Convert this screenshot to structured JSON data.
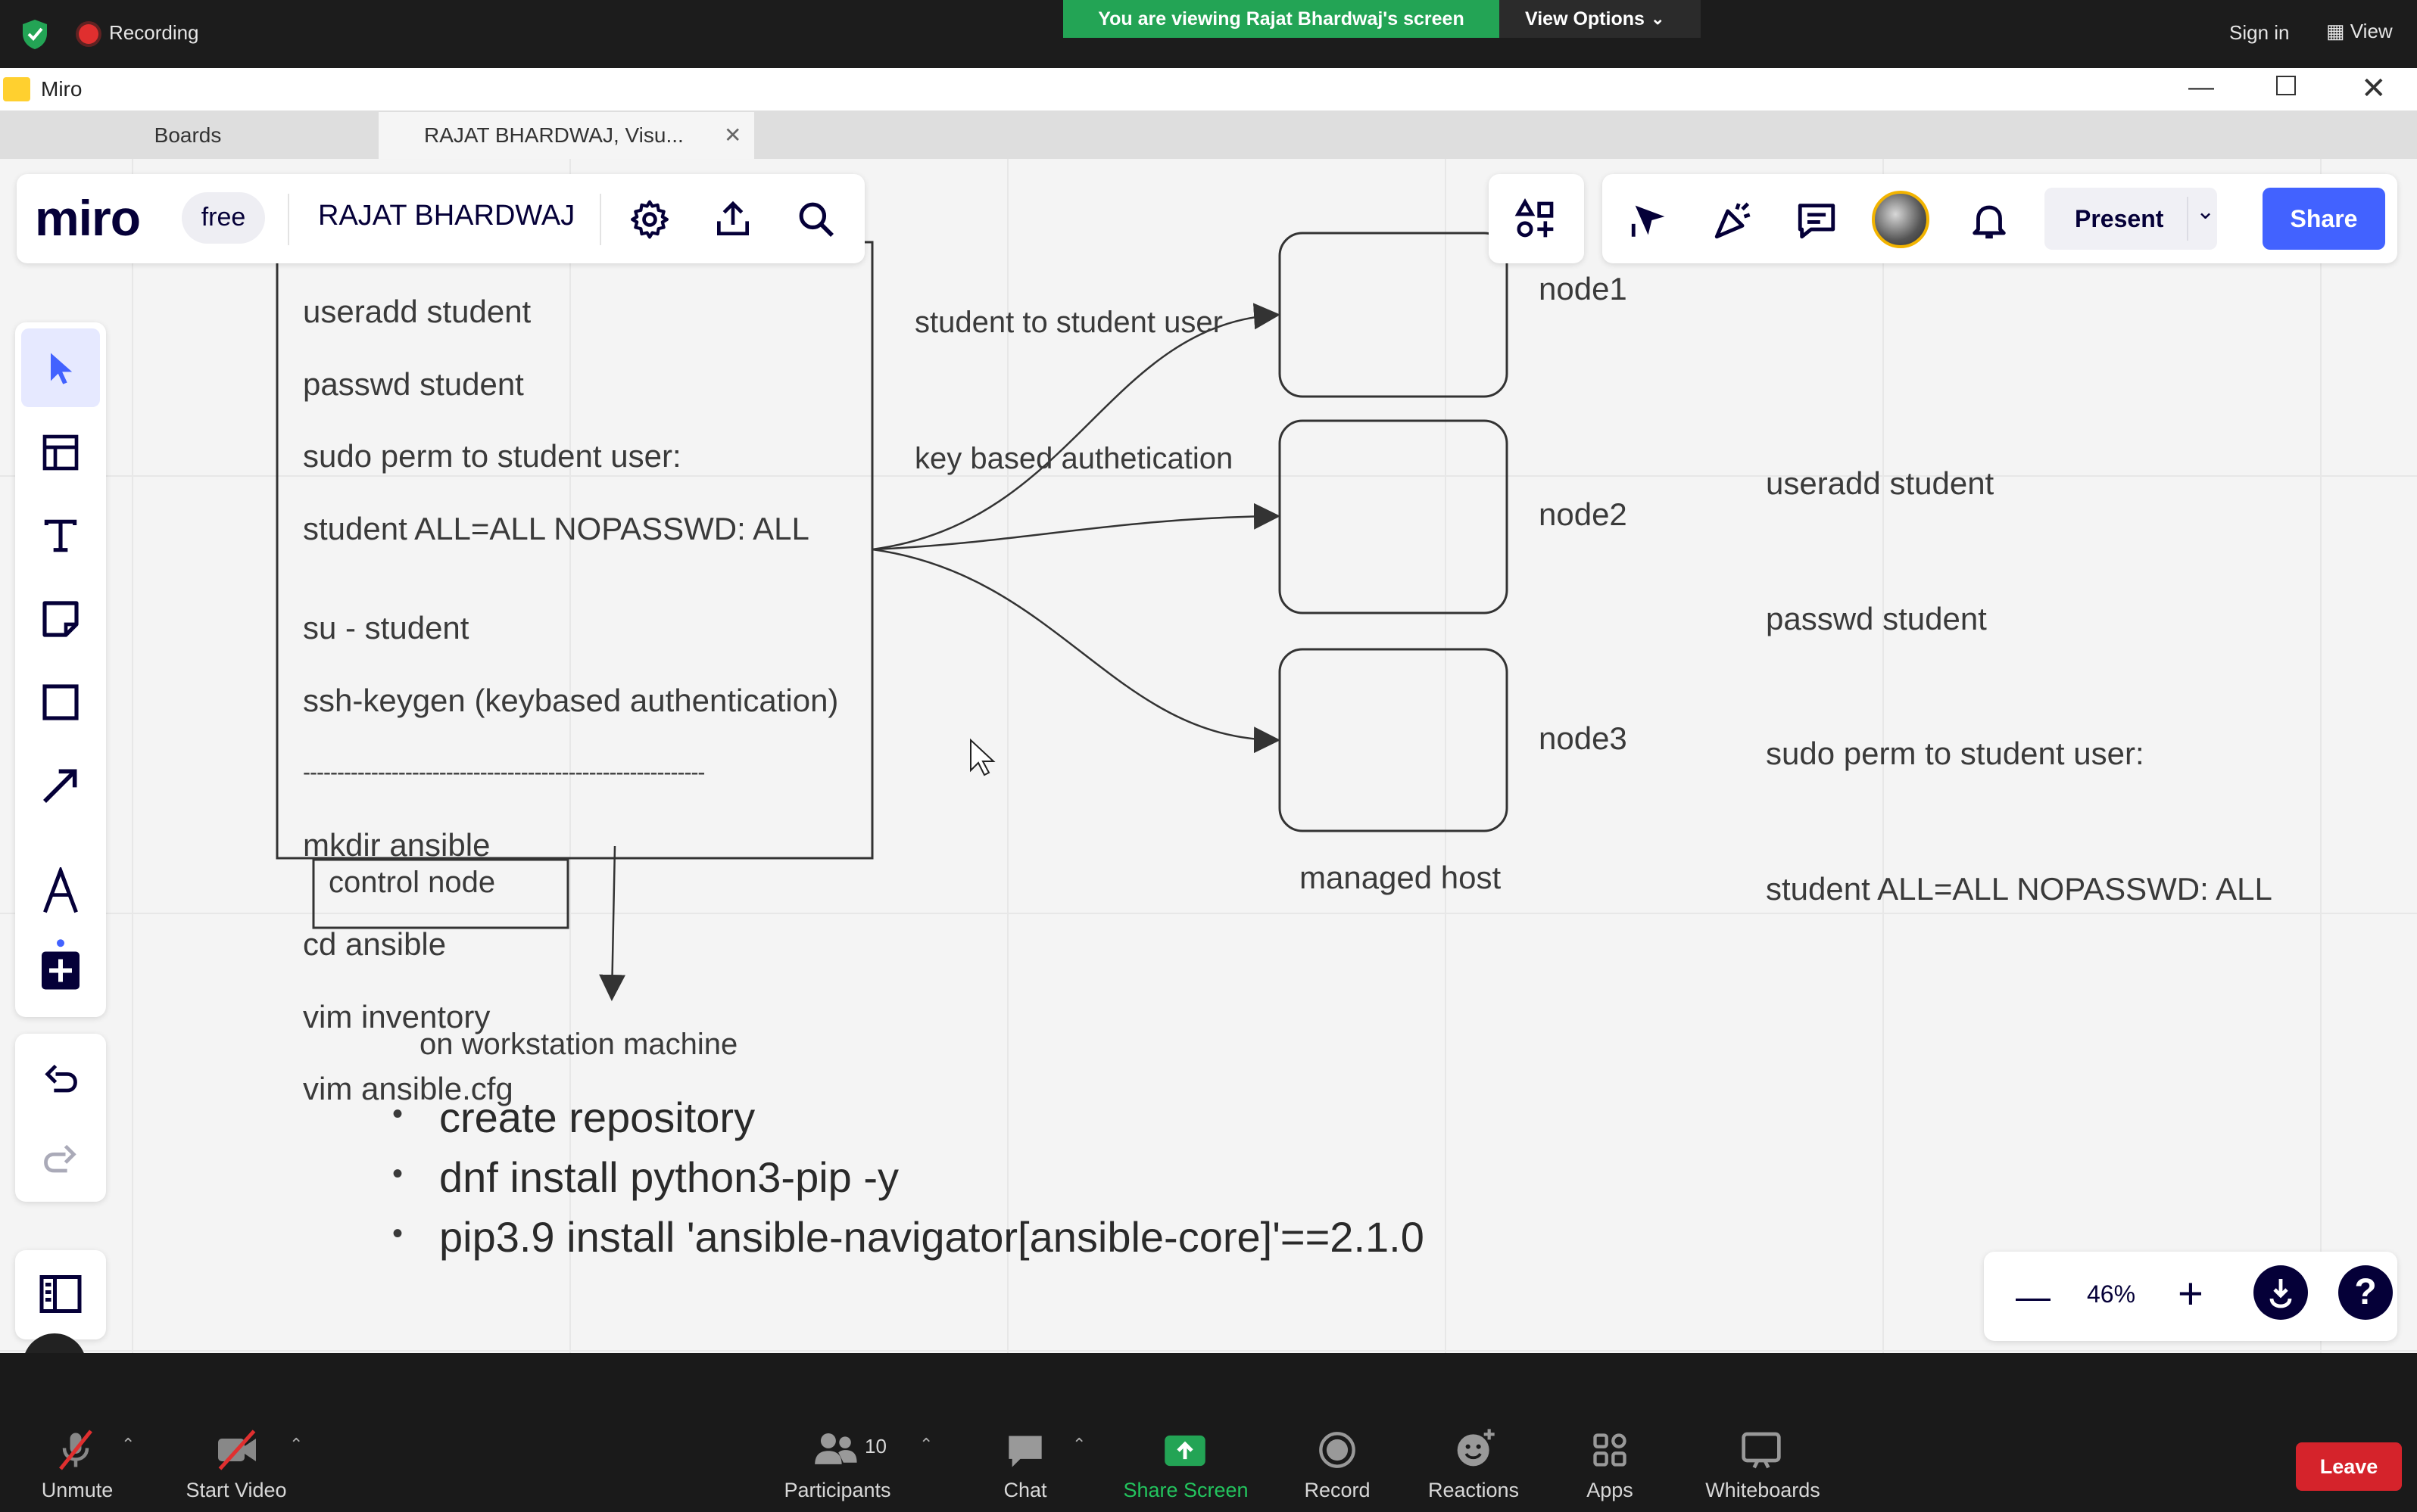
{
  "zoom_top": {
    "recording_label": "Recording",
    "viewing_banner": "You are viewing Rajat Bhardwaj's screen",
    "view_options_label": "View Options",
    "sign_in_label": "Sign in",
    "view_label": "View"
  },
  "window": {
    "title": "Miro"
  },
  "tabs": [
    {
      "label": "Boards"
    },
    {
      "label": "RAJAT BHARDWAJ, Visu..."
    }
  ],
  "toolbar": {
    "logo": "miro",
    "plan_badge": "free",
    "board_name": "RAJAT BHARDWAJ",
    "present_label": "Present",
    "share_label": "Share"
  },
  "zoom_control": {
    "level": "46%"
  },
  "board": {
    "main_box_lines": [
      "useradd student",
      "passwd student",
      "sudo perm to student user:",
      "student ALL=ALL NOPASSWD: ALL",
      "",
      "su - student",
      "ssh-keygen (keybased authentication)",
      "-----------------------------------------------------------",
      "mkdir ansible",
      "",
      "cd ansible",
      "vim inventory",
      "vim ansible.cfg"
    ],
    "control_node_label": "control node",
    "arrow_note": [
      "student to student user",
      "key based authetication"
    ],
    "nodes": [
      "node1",
      "node2",
      "node3"
    ],
    "managed_host_label": "managed host",
    "right_note_lines": [
      "useradd student",
      "passwd student",
      "sudo perm to student user:",
      "student ALL=ALL NOPASSWD: ALL"
    ],
    "workstation_label": "on workstation machine",
    "bullets": [
      "create repository",
      "dnf install python3-pip -y",
      "pip3.9 install 'ansible-navigator[ansible-core]'==2.1.0"
    ]
  },
  "zoom_bottom": {
    "unmute": "Unmute",
    "start_video": "Start Video",
    "participants": "Participants",
    "participants_count": "10",
    "chat": "Chat",
    "share_screen": "Share Screen",
    "record": "Record",
    "reactions": "Reactions",
    "apps": "Apps",
    "whiteboards": "Whiteboards",
    "leave": "Leave"
  },
  "colors": {
    "zoom_green": "#23a455",
    "miro_blue": "#4262ff",
    "leave_red": "#d5232b",
    "miro_navy": "#050038"
  }
}
